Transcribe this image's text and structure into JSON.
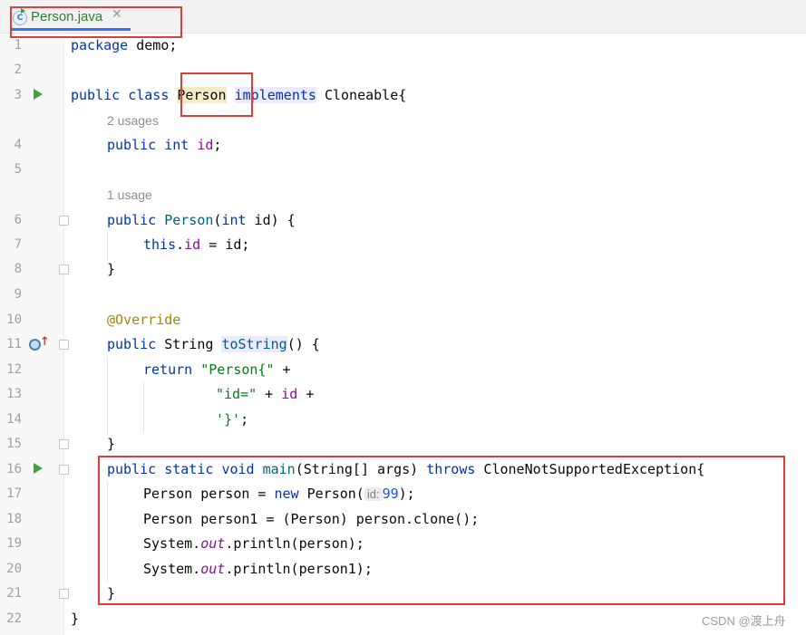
{
  "tab": {
    "file_name": "Person.java",
    "close_glyph": "✕",
    "icon_letter": "C"
  },
  "usages": {
    "field": "2 usages",
    "constructor": "1 usage"
  },
  "gutter": {
    "line_numbers": [
      "1",
      "2",
      "3",
      "4",
      "5",
      "6",
      "7",
      "8",
      "9",
      "10",
      "11",
      "12",
      "13",
      "14",
      "15",
      "16",
      "17",
      "18",
      "19",
      "20",
      "21",
      "22"
    ]
  },
  "code": {
    "l1": {
      "kw": "package",
      "rest": " demo;"
    },
    "l3": {
      "kw1": "public",
      "kw2": "class",
      "cls": "Person",
      "kw3": "implements",
      "rest": "Cloneable{"
    },
    "l4": {
      "kw1": "public",
      "kw2": "int",
      "field": "id",
      "end": ";"
    },
    "l6": {
      "kw": "public",
      "fn": "Person",
      "open": "(",
      "kw2": "int",
      "rest": " id) {"
    },
    "l7": {
      "kw": "this",
      "dot": ".",
      "field": "id",
      "rest": " = id;"
    },
    "l8": "}",
    "l10": "@Override",
    "l11": {
      "kw": "public",
      "type": " String ",
      "fn": "toString",
      "rest": "() {"
    },
    "l12": {
      "kw": "return",
      "str": "\"Person{\"",
      "rest": " +"
    },
    "l13": {
      "str": "\"id=\"",
      "mid": " + ",
      "field": "id",
      "rest": " +"
    },
    "l14": {
      "str": "'}'",
      "rest": ";"
    },
    "l15": "}",
    "l16": {
      "kw1": "public",
      "kw2": "static",
      "kw3": "void",
      "fn": "main",
      "mid": "(String[] args) ",
      "kw4": "throws",
      "rest": " CloneNotSupportedException{"
    },
    "l17": {
      "pre": "Person person = ",
      "kw": "new",
      "mid": " Person(",
      "hint": "id:",
      "num": "99",
      "rest": ");"
    },
    "l18": "Person person1 = (Person) person.clone();",
    "l19": {
      "pre": "System.",
      "italic": "out",
      "rest": ".println(person);"
    },
    "l20": {
      "pre": "System.",
      "italic": "out",
      "rest": ".println(person1);"
    },
    "l21": "}",
    "l22": "}"
  },
  "watermark": "CSDN @渡上舟",
  "colors": {
    "keyword": "#0033b3",
    "field": "#871094",
    "string": "#067d17",
    "number": "#1750eb",
    "annotation": "#9e880d",
    "method": "#00627a",
    "red_box": "#e03c3c",
    "tab_underline": "#3574f0"
  }
}
